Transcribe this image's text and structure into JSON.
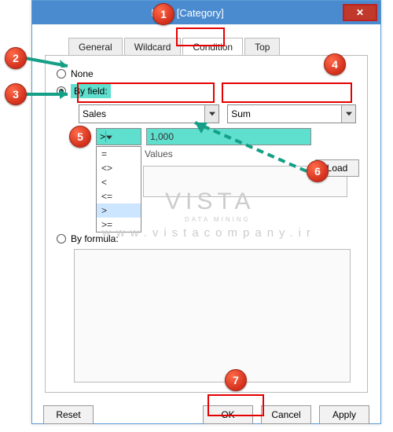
{
  "window": {
    "title": "Filter [Category]"
  },
  "tabs": {
    "general": "General",
    "wildcard": "Wildcard",
    "condition": "Condition",
    "top": "Top"
  },
  "radios": {
    "none": "None",
    "byfield": "By field:",
    "byformula": "By formula:"
  },
  "fields": {
    "sales": "Sales",
    "agg": "Sum"
  },
  "value": {
    "op_selected": ">",
    "num": "1,000",
    "values_label": "Values",
    "load": "Load"
  },
  "op_options": [
    "=",
    "<>",
    "<",
    "<=",
    ">",
    ">="
  ],
  "buttons": {
    "reset": "Reset",
    "ok": "OK",
    "cancel": "Cancel",
    "apply": "Apply"
  },
  "callouts": {
    "c1": "1",
    "c2": "2",
    "c3": "3",
    "c4": "4",
    "c5": "5",
    "c6": "6",
    "c7": "7"
  },
  "watermark": {
    "brand": "VISTA",
    "sub": "DATA MINING",
    "url": "www.vistacompany.ir"
  }
}
